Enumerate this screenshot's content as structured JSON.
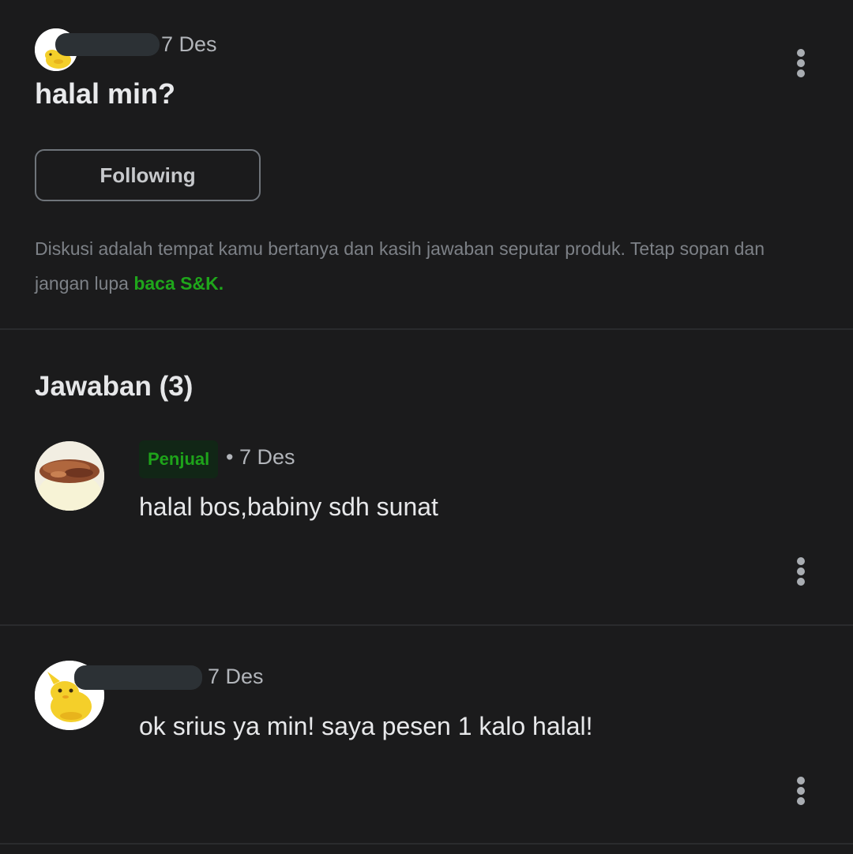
{
  "question": {
    "date": "7 Des",
    "title": "halal min?",
    "follow_label": "Following",
    "disclaimer_text": "Diskusi adalah tempat kamu bertanya dan kasih jawaban seputar produk. Tetap sopan dan jangan lupa ",
    "disclaimer_link": "baca S&K."
  },
  "answers_header": "Jawaban (3)",
  "answers": [
    {
      "badge": "Penjual",
      "date": "• 7 Des",
      "text": "halal bos,babiny sdh sunat"
    },
    {
      "date": "7 Des",
      "text": "ok srius ya min! saya pesen 1 kalo halal!"
    }
  ],
  "colors": {
    "background": "#1b1b1c",
    "accent_green": "#1fa61b",
    "badge_bg": "#112616"
  },
  "icons": [
    "more-vertical-icon",
    "avatar-mascot",
    "avatar-food"
  ]
}
